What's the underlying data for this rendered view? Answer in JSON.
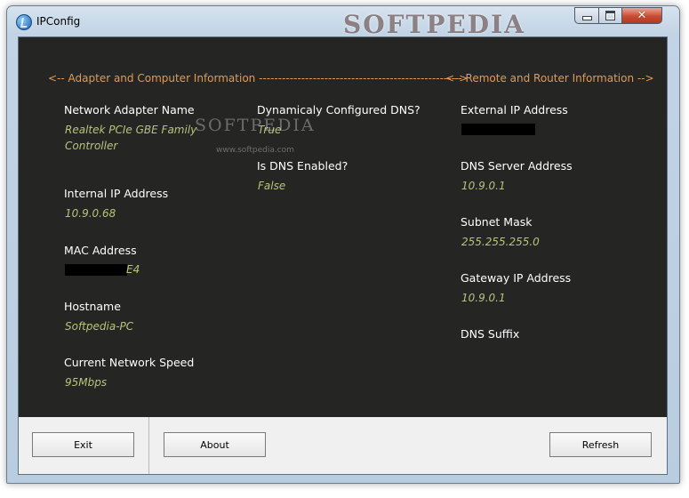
{
  "window": {
    "title": "IPConfig",
    "watermark": "SOFTPEDIA",
    "controls": {
      "minimize": "minimize",
      "maximize": "maximize",
      "close": "✕"
    }
  },
  "sections": {
    "adapter_header": "<-- Adapter and Computer Information ---------------------------------------------------->",
    "router_header": "<-- Remote and Router Information -->"
  },
  "adapter": {
    "network_adapter_name": {
      "label": "Network Adapter Name",
      "value": "Realtek PCIe GBE Family Controller"
    },
    "internal_ip": {
      "label": "Internal IP Address",
      "value": "10.9.0.68"
    },
    "mac": {
      "label": "MAC Address",
      "value_visible_suffix": "E4"
    },
    "hostname": {
      "label": "Hostname",
      "value": "Softpedia-PC"
    },
    "network_speed": {
      "label": "Current Network Speed",
      "value": "95Mbps"
    },
    "dynamic_dns": {
      "label": "Dynamicaly Configured DNS?",
      "value": "True"
    },
    "dns_enabled": {
      "label": "Is DNS Enabled?",
      "value": "False"
    }
  },
  "router": {
    "external_ip": {
      "label": "External IP Address"
    },
    "dns_server": {
      "label": "DNS Server Address",
      "value": "10.9.0.1"
    },
    "subnet_mask": {
      "label": "Subnet Mask",
      "value": "255.255.255.0"
    },
    "gateway_ip": {
      "label": "Gateway IP Address",
      "value": "10.9.0.1"
    },
    "dns_suffix": {
      "label": "DNS Suffix",
      "value": ""
    }
  },
  "watermark_overlay": {
    "text": "SOFTPEDIA",
    "url": "www.softpedia.com"
  },
  "buttons": {
    "exit": "Exit",
    "about": "About",
    "refresh": "Refresh"
  },
  "colors": {
    "panel": "#252524",
    "header": "#e39a52",
    "label": "#ffffff",
    "value": "#b5c47a"
  },
  "icons": {
    "app": "app-icon",
    "minimize": "minimize-icon",
    "maximize": "maximize-icon",
    "close": "close-icon"
  }
}
